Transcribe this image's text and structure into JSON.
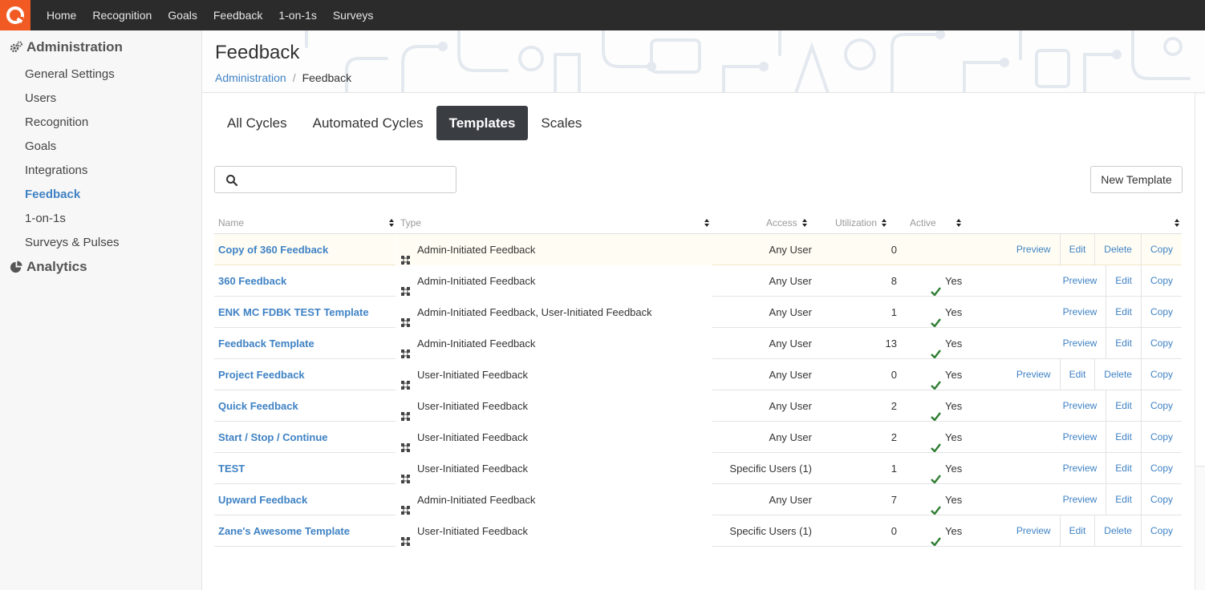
{
  "topnav": {
    "items": [
      "Home",
      "Recognition",
      "Goals",
      "Feedback",
      "1-on-1s",
      "Surveys"
    ],
    "brand_color": "#f15a22"
  },
  "sidebar": {
    "admin_label": "Administration",
    "items": [
      "General Settings",
      "Users",
      "Recognition",
      "Goals",
      "Integrations",
      "Feedback",
      "1-on-1s",
      "Surveys & Pulses"
    ],
    "active_item": "Feedback",
    "analytics_label": "Analytics"
  },
  "header": {
    "title": "Feedback",
    "breadcrumb_root": "Administration",
    "breadcrumb_sep": "/",
    "breadcrumb_current": "Feedback"
  },
  "tabs": [
    {
      "label": "All Cycles",
      "active": false
    },
    {
      "label": "Automated Cycles",
      "active": false
    },
    {
      "label": "Templates",
      "active": true
    },
    {
      "label": "Scales",
      "active": false
    }
  ],
  "search": {
    "placeholder": "",
    "value": ""
  },
  "new_button_label": "New Template",
  "table": {
    "columns": {
      "name": "Name",
      "type": "Type",
      "access": "Access",
      "utilization": "Utilization",
      "active": "Active"
    },
    "actions": {
      "preview": "Preview",
      "edit": "Edit",
      "delete": "Delete",
      "copy": "Copy"
    },
    "rows": [
      {
        "name": "Copy of 360 Feedback",
        "type": "Admin-Initiated Feedback",
        "access": "Any User",
        "utilization": "0",
        "active": "",
        "deletable": true,
        "highlight": true
      },
      {
        "name": "360 Feedback",
        "type": "Admin-Initiated Feedback",
        "access": "Any User",
        "utilization": "8",
        "active": "Yes",
        "deletable": false,
        "highlight": false
      },
      {
        "name": "ENK MC FDBK TEST Template",
        "type": "Admin-Initiated Feedback, User-Initiated Feedback",
        "access": "Any User",
        "utilization": "1",
        "active": "Yes",
        "deletable": false,
        "highlight": false
      },
      {
        "name": "Feedback Template",
        "type": "Admin-Initiated Feedback",
        "access": "Any User",
        "utilization": "13",
        "active": "Yes",
        "deletable": false,
        "highlight": false
      },
      {
        "name": "Project Feedback",
        "type": "User-Initiated Feedback",
        "access": "Any User",
        "utilization": "0",
        "active": "Yes",
        "deletable": true,
        "highlight": false
      },
      {
        "name": "Quick Feedback",
        "type": "User-Initiated Feedback",
        "access": "Any User",
        "utilization": "2",
        "active": "Yes",
        "deletable": false,
        "highlight": false
      },
      {
        "name": "Start / Stop / Continue",
        "type": "User-Initiated Feedback",
        "access": "Any User",
        "utilization": "2",
        "active": "Yes",
        "deletable": false,
        "highlight": false
      },
      {
        "name": "TEST",
        "type": "User-Initiated Feedback",
        "access": "Specific Users (1)",
        "utilization": "1",
        "active": "Yes",
        "deletable": false,
        "highlight": false
      },
      {
        "name": "Upward Feedback",
        "type": "Admin-Initiated Feedback",
        "access": "Any User",
        "utilization": "7",
        "active": "Yes",
        "deletable": false,
        "highlight": false
      },
      {
        "name": "Zane's Awesome Template",
        "type": "User-Initiated Feedback",
        "access": "Specific Users (1)",
        "utilization": "0",
        "active": "Yes",
        "deletable": true,
        "highlight": false
      }
    ]
  },
  "colors": {
    "link": "#3f82c4",
    "active_tab_bg": "#3a3d42",
    "check": "#2e7d32",
    "highlight_row": "#fffdf3"
  }
}
